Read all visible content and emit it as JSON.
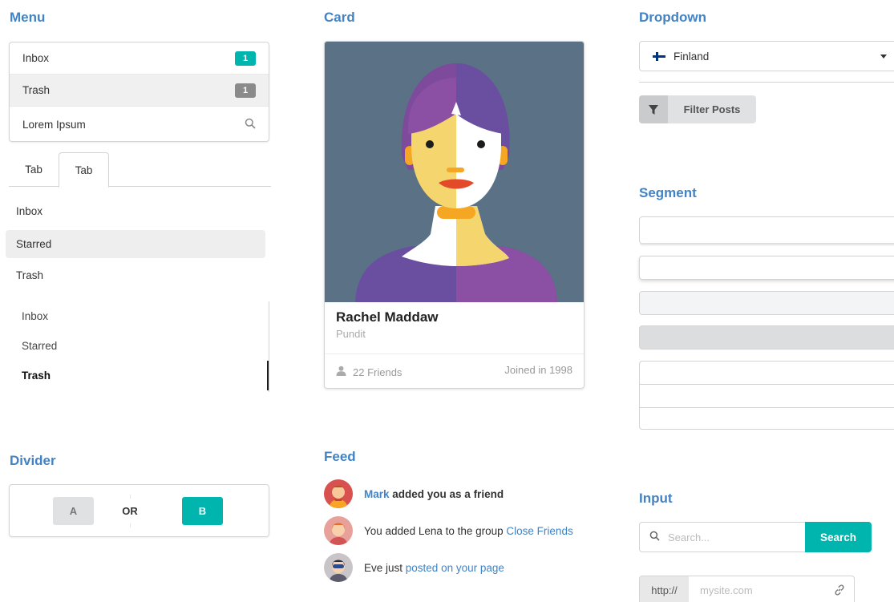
{
  "titles": {
    "menu": "Menu",
    "card": "Card",
    "dropdown": "Dropdown",
    "segment": "Segment",
    "divider": "Divider",
    "feed": "Feed",
    "input": "Input"
  },
  "menu": {
    "items": [
      {
        "label": "Inbox",
        "badge": "1"
      },
      {
        "label": "Trash",
        "badge": "1"
      }
    ],
    "search_placeholder": "Lorem Ipsum"
  },
  "tabs": [
    {
      "label": "Tab"
    },
    {
      "label": "Tab"
    }
  ],
  "plain_menu": [
    "Inbox",
    "Starred",
    "Trash"
  ],
  "vertical_menu": [
    "Inbox",
    "Starred",
    "Trash"
  ],
  "divider": {
    "a": "A",
    "or": "OR",
    "b": "B"
  },
  "card": {
    "name": "Rachel Maddaw",
    "meta": "Pundit",
    "friends": "22 Friends",
    "joined": "Joined in 1998"
  },
  "feed": [
    {
      "actor": "Mark",
      "text": "added you as a friend"
    },
    {
      "pre": "You added Lena to the group ",
      "link": "Close Friends"
    },
    {
      "pre": "Eve just ",
      "link": "posted on your page"
    }
  ],
  "dropdown": {
    "selected": "Finland"
  },
  "filter": {
    "label": "Filter Posts"
  },
  "input": {
    "search_placeholder": "Search...",
    "search_button": "Search",
    "url_label": "http://",
    "url_placeholder": "mysite.com"
  },
  "colors": {
    "accent": "#4183c4",
    "teal": "#00b5ad",
    "card_bg": "#5a7186"
  }
}
